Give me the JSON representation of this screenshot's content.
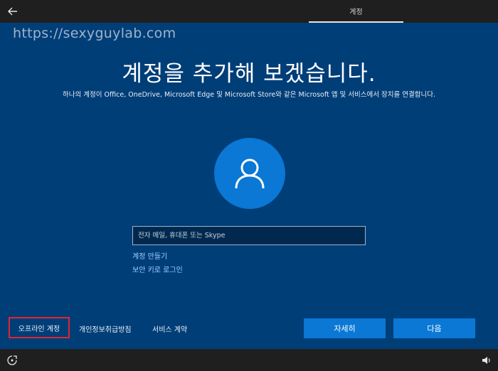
{
  "topbar": {
    "tab_label": "계정"
  },
  "watermark": "https://sexyguylab.com",
  "main": {
    "title": "계정을 추가해 보겠습니다.",
    "subtitle": "하나의 계정이 Office, OneDrive, Microsoft Edge 및 Microsoft Store와 같은 Microsoft 앱 및 서비스에서 장치를 연결합니다.",
    "email_placeholder": "전자 메일, 휴대폰 또는 Skype",
    "email_value": "",
    "create_account_link": "계정 만들기",
    "security_key_link": "보안 키로 로그인"
  },
  "footer": {
    "offline_account": "오프라인 계정",
    "privacy": "개인정보취급방침",
    "terms": "서비스 계약",
    "more_button": "자세히",
    "next_button": "다음"
  },
  "colors": {
    "background": "#003e78",
    "accent": "#0a78d4",
    "link": "#9fd0ff",
    "highlight_border": "#e2252e"
  },
  "icons": {
    "back": "back-arrow-icon",
    "avatar": "user-icon",
    "ease_of_access": "ease-of-access-icon",
    "volume": "volume-icon"
  }
}
